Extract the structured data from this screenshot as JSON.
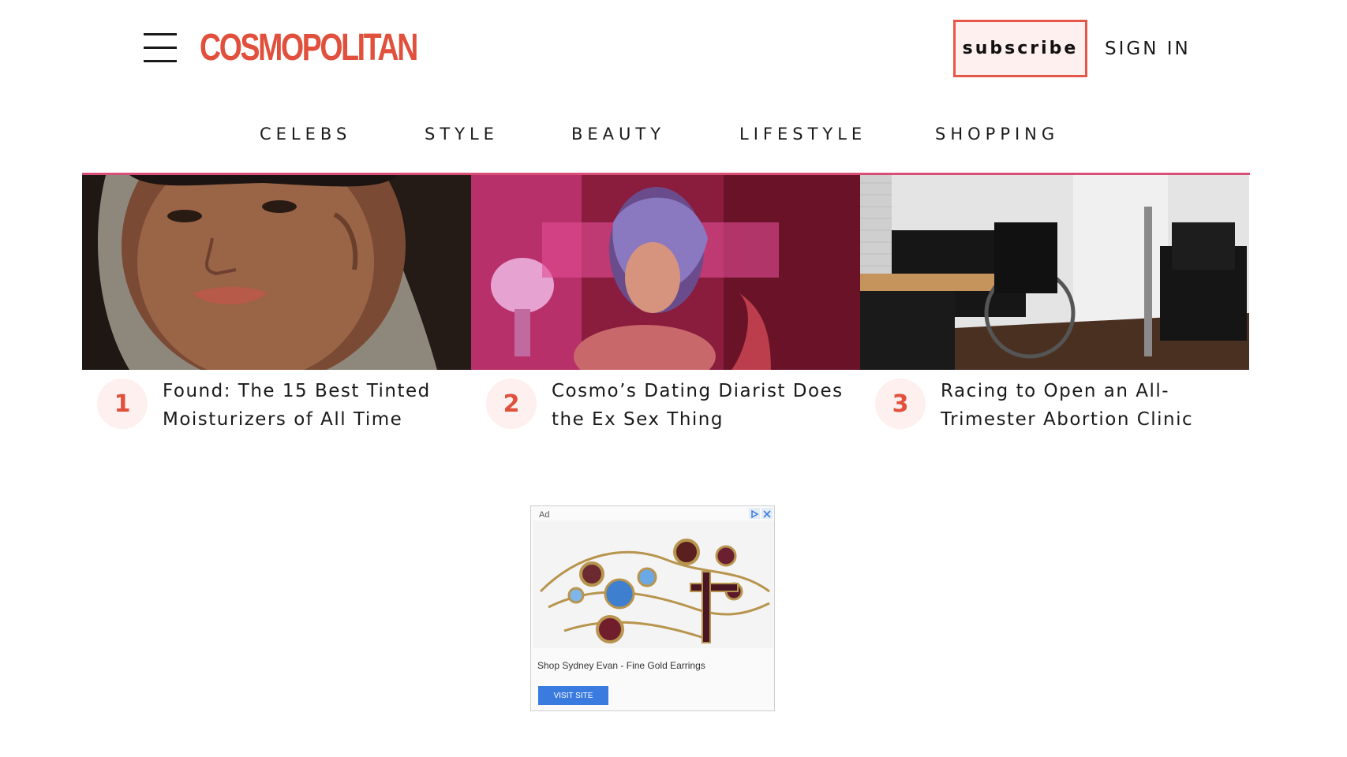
{
  "header": {
    "logo_text": "COSMOPOLITAN",
    "subscribe_label": "subscribe",
    "signin_label": "SIGN IN"
  },
  "nav": {
    "items": [
      {
        "label": "CELEBS"
      },
      {
        "label": "STYLE"
      },
      {
        "label": "BEAUTY"
      },
      {
        "label": "LIFESTYLE"
      },
      {
        "label": "SHOPPING"
      }
    ]
  },
  "stories": [
    {
      "number": "1",
      "title": "Found: The 15 Best Tinted Moisturizers of All Time"
    },
    {
      "number": "2",
      "title": "Cosmo’s Dating Diarist Does the Ex Sex Thing"
    },
    {
      "number": "3",
      "title": "Racing to Open an All-Trimester Abortion Clinic"
    }
  ],
  "ad": {
    "label": "Ad",
    "text": "Shop Sydney Evan - Fine Gold Earrings",
    "button_label": "VISIT SITE"
  },
  "colors": {
    "brand": "#e0503c",
    "nav_rule": "#d94e76",
    "subscribe_border": "#e6574a",
    "badge_bg": "#fdf0ee",
    "ad_button": "#3a7be0"
  }
}
